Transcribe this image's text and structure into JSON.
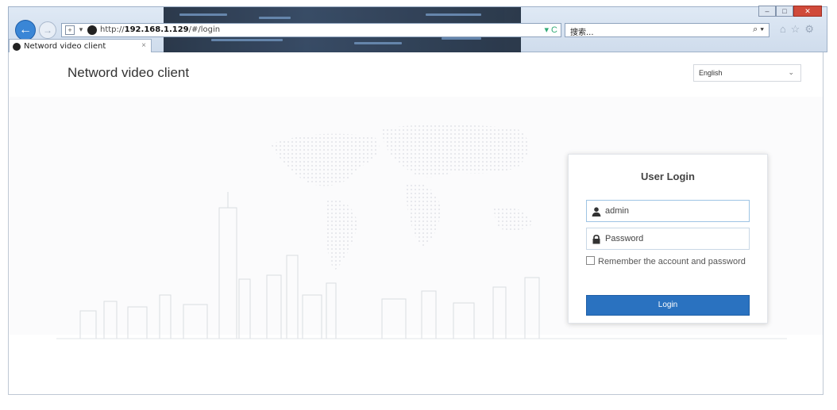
{
  "browser": {
    "url_prefix": "http://",
    "url_host": "192.168.1.129",
    "url_path": "/#/login",
    "search_placeholder": "搜索...",
    "tab_title": "Netword video client",
    "tab_close": "×",
    "back_glyph": "←",
    "forward_glyph": "→",
    "refresh_glyph": "▾ C",
    "search_glyph": "⌕ ▾",
    "toolbar_icons": "⌂☆⚙"
  },
  "header": {
    "title": "Netword video client",
    "language": {
      "selected": "English",
      "chevron": "⌄"
    }
  },
  "login": {
    "title": "User Login",
    "username_value": "admin",
    "password_placeholder": "Password",
    "remember_label": "Remember the account and password",
    "button_label": "Login"
  },
  "colors": {
    "accent": "#2a72c0",
    "field_border": "#9ec4e4",
    "chrome": "#cfdcec"
  }
}
